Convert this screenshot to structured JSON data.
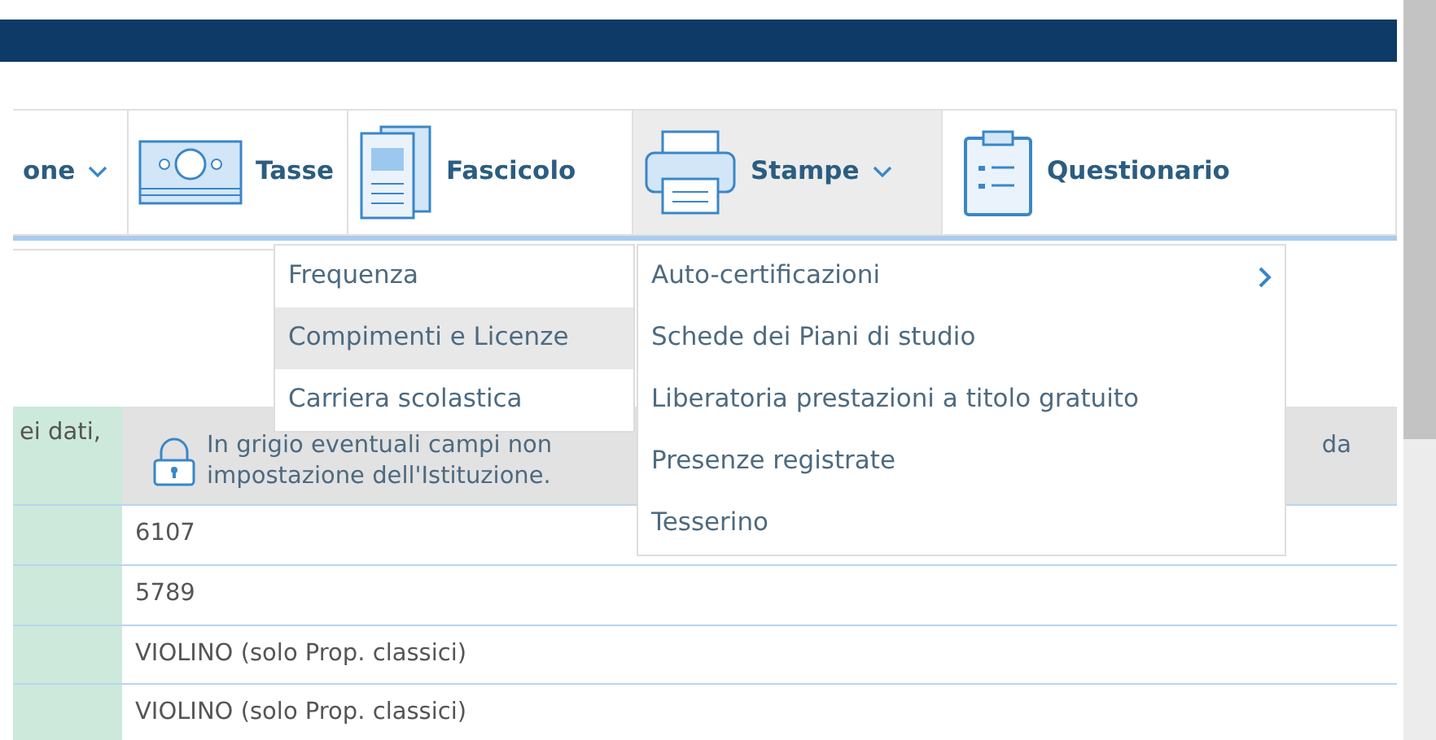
{
  "tabs": [
    {
      "label": "one",
      "dropdown": true,
      "selected": false
    },
    {
      "label": "Tasse",
      "dropdown": false,
      "selected": false
    },
    {
      "label": "Fascicolo",
      "dropdown": false,
      "selected": false
    },
    {
      "label": "Stampe",
      "dropdown": true,
      "selected": true
    },
    {
      "label": "Questionario",
      "dropdown": false,
      "selected": false
    }
  ],
  "menus": [
    {
      "items": [
        {
          "label": "Frequenza",
          "selected": false,
          "submenu": false
        },
        {
          "label": "Compimenti e Licenze",
          "selected": true,
          "submenu": false
        },
        {
          "label": "Carriera scolastica",
          "selected": false,
          "submenu": false
        }
      ]
    },
    {
      "items": [
        {
          "label": "Auto-certificazioni",
          "selected": false,
          "submenu": true
        },
        {
          "label": "Schede dei Piani di studio",
          "selected": false,
          "submenu": false
        },
        {
          "label": "Liberatoria prestazioni a titolo gratuito",
          "selected": false,
          "submenu": false
        },
        {
          "label": "Presenze registrate",
          "selected": false,
          "submenu": false
        },
        {
          "label": "Tesserino",
          "selected": false,
          "submenu": false
        }
      ]
    }
  ],
  "table": {
    "note": {
      "label": "ei dati,",
      "lines": [
        "In grigio eventuali campi non",
        "impostazione dell'Istituzione."
      ],
      "tail": "da"
    },
    "rows": [
      "6107",
      "5789",
      "VIOLINO (solo Prop. classici)",
      "VIOLINO (solo Prop. classici)"
    ]
  }
}
